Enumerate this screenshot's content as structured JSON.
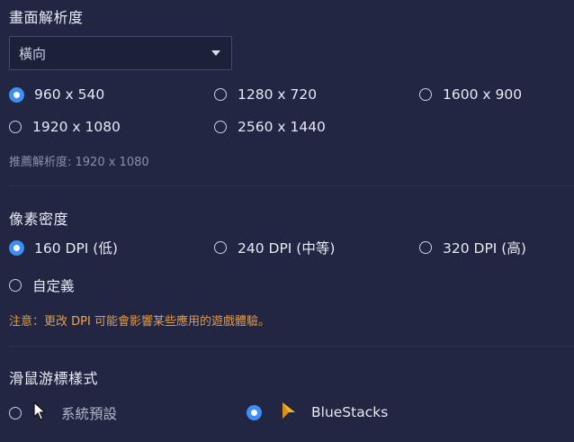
{
  "resolution": {
    "title": "畫面解析度",
    "orientation_value": "橫向",
    "options": [
      "960 x 540",
      "1280 x 720",
      "1600 x 900",
      "1920 x 1080",
      "2560 x 1440"
    ],
    "selected": "960 x 540",
    "recommended": "推薦解析度: 1920 x 1080"
  },
  "density": {
    "title": "像素密度",
    "options": [
      "160 DPI (低)",
      "240 DPI (中等)",
      "320 DPI (高)",
      "自定義"
    ],
    "selected": "160 DPI (低)",
    "warning_prefix": "注意：更改",
    "warning_dpi": "DPI",
    "warning_suffix": "可能會影響某些應用的遊戲體驗。"
  },
  "cursor": {
    "title": "滑鼠游標樣式",
    "options": [
      "系統預設",
      "BlueStacks"
    ],
    "selected": "BlueStacks",
    "icons": [
      "arrow-cursor-icon",
      "bluestacks-cursor-icon"
    ]
  },
  "colors": {
    "background": "#232642",
    "accent": "#3d8ef5",
    "warning": "#e59b3e",
    "bluestacks_cursor": "#f5b52a"
  }
}
